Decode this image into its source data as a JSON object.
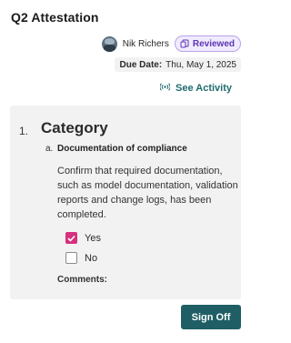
{
  "page": {
    "title": "Q2 Attestation"
  },
  "owner": {
    "name": "Nik Richers",
    "avatar_icon": "user-avatar-photo"
  },
  "status_badge": {
    "label": "Reviewed",
    "icon": "document-copy-icon",
    "color": "#5b36b5",
    "background": "#f1ebff"
  },
  "due": {
    "label": "Due Date:",
    "value": "Thu, May 1, 2025"
  },
  "activity": {
    "label": "See Activity",
    "icon": "broadcast-signal-icon",
    "color": "#1f6b6e"
  },
  "section": {
    "number": "1.",
    "title": "Category",
    "question": {
      "letter": "a.",
      "title": "Documentation of compliance",
      "description": "Confirm that required documentation, such as model documentation, validation reports and change logs, has been completed.",
      "options": [
        {
          "label": "Yes",
          "checked": true
        },
        {
          "label": "No",
          "checked": false
        }
      ],
      "comments_label": "Comments:"
    }
  },
  "actions": {
    "sign_off_label": "Sign Off",
    "accent": "#1f5e64"
  }
}
